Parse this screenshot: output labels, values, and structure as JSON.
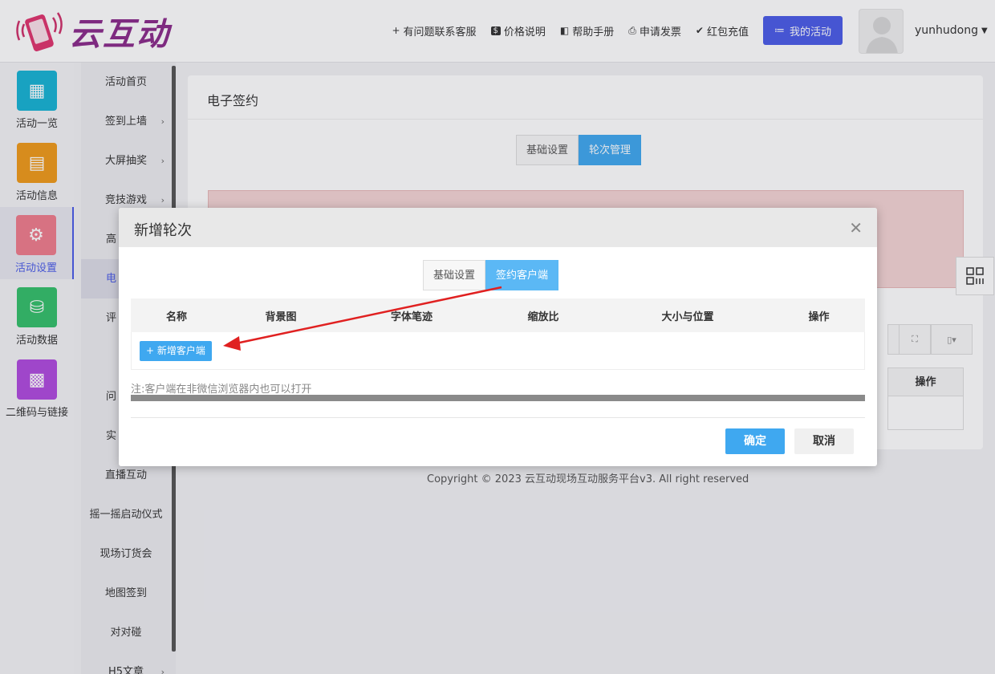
{
  "header": {
    "logo_text": "云互动",
    "nav": [
      {
        "icon": "user-plus-icon",
        "glyph": "+",
        "label": "有问题联系客服"
      },
      {
        "icon": "dollar-icon",
        "glyph": "$",
        "label": "价格说明"
      },
      {
        "icon": "book-icon",
        "glyph": "◧",
        "label": "帮助手册"
      },
      {
        "icon": "printer-icon",
        "glyph": "⎙",
        "label": "申请发票"
      },
      {
        "icon": "shield-check-icon",
        "glyph": "✔",
        "label": "红包充值"
      }
    ],
    "my_activity": "我的活动",
    "username": "yunhudong"
  },
  "icon_sidebar": [
    {
      "label": "活动一览",
      "color": "#16b3d4",
      "icon": "grid-icon"
    },
    {
      "label": "活动信息",
      "color": "#f09a1a",
      "icon": "document-icon"
    },
    {
      "label": "活动设置",
      "color": "#f07d8c",
      "icon": "gear-icon"
    },
    {
      "label": "活动数据",
      "color": "#34c06a",
      "icon": "database-icon"
    },
    {
      "label": "二维码与链接",
      "color": "#b04adf",
      "icon": "qrcode-icon"
    }
  ],
  "submenu": [
    {
      "label": "活动首页",
      "arrow": false
    },
    {
      "label": "签到上墙",
      "arrow": true
    },
    {
      "label": "大屏抽奖",
      "arrow": true
    },
    {
      "label": "竞技游戏",
      "arrow": true
    },
    {
      "label": "高",
      "arrow": false
    },
    {
      "label": "电",
      "arrow": false
    },
    {
      "label": "评",
      "arrow": false
    },
    {
      "label": "",
      "arrow": false
    },
    {
      "label": "问",
      "arrow": false
    },
    {
      "label": "实",
      "arrow": false
    },
    {
      "label": "直播互动",
      "arrow": false
    },
    {
      "label": "摇一摇启动仪式",
      "arrow": false
    },
    {
      "label": "现场订货会",
      "arrow": false
    },
    {
      "label": "地图签到",
      "arrow": false
    },
    {
      "label": "对对碰",
      "arrow": false
    },
    {
      "label": "H5文章",
      "arrow": true
    }
  ],
  "panel": {
    "title": "电子签约",
    "tabs": [
      "基础设置",
      "轮次管理"
    ],
    "table_op_header": "操作"
  },
  "copyright": "Copyright © 2023 云互动现场互动服务平台v3. All right reserved",
  "modal": {
    "title": "新增轮次",
    "tabs": [
      "基础设置",
      "签约客户端"
    ],
    "columns": [
      "名称",
      "背景图",
      "字体笔迹",
      "缩放比",
      "大小与位置",
      "操作"
    ],
    "add_client": "+ 新增客户端",
    "note": "注:客户端在非微信浏览器内也可以打开",
    "ok": "确定",
    "cancel": "取消"
  }
}
